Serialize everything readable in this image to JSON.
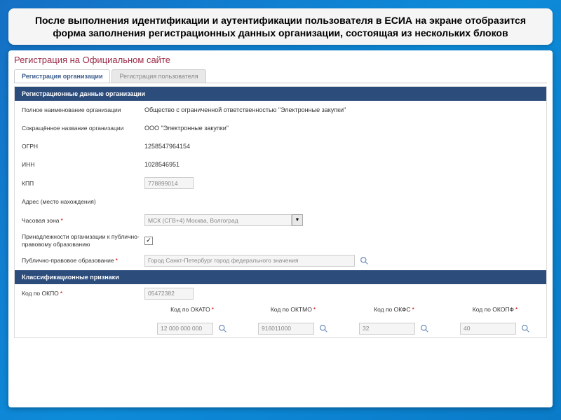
{
  "caption": "После выполнения идентификации и аутентификации пользователя в ЕСИА на экране отобразится форма заполнения регистрационных данных организации, состоящая из нескольких блоков",
  "page_title": "Регистрация на Официальном сайте",
  "tabs": {
    "org": "Регистрация организации",
    "user": "Регистрация пользователя"
  },
  "section1": {
    "header": "Регистрационные данные организации",
    "full_name_label": "Полное наименование организации",
    "full_name_value": "Общество с ограниченной ответственностью \"Электронные закупки\"",
    "short_name_label": "Сокращённое название организации",
    "short_name_value": "ООО \"Электронные закупки\"",
    "ogrn_label": "ОГРН",
    "ogrn_value": "1258547964154",
    "inn_label": "ИНН",
    "inn_value": "1028546951",
    "kpp_label": "КПП",
    "kpp_value": "778899014",
    "address_label": "Адрес (место нахождения)",
    "timezone_label": "Часовая зона",
    "timezone_value": "МСК (СГВ+4) Москва, Волгоград",
    "public_org_label": "Принадлежности организации к публично-правовому образованию",
    "public_entity_label": "Публично-правовое образование",
    "public_entity_value": "Город Санкт-Петербург город федерального значения"
  },
  "section2": {
    "header": "Классификационные признаки",
    "okpo_label": "Код по ОКПО",
    "okpo_value": "05472382",
    "okato_label": "Код по ОКАТО",
    "okato_value": "12 000 000 000",
    "oktmo_label": "Код по ОКТМО",
    "oktmo_value": "916011000",
    "okfs_label": "Код по ОКФС",
    "okfs_value": "32",
    "okopf_label": "Код по ОКОПФ",
    "okopf_value": "40"
  },
  "asterisk": "*",
  "checkmark": "✓"
}
